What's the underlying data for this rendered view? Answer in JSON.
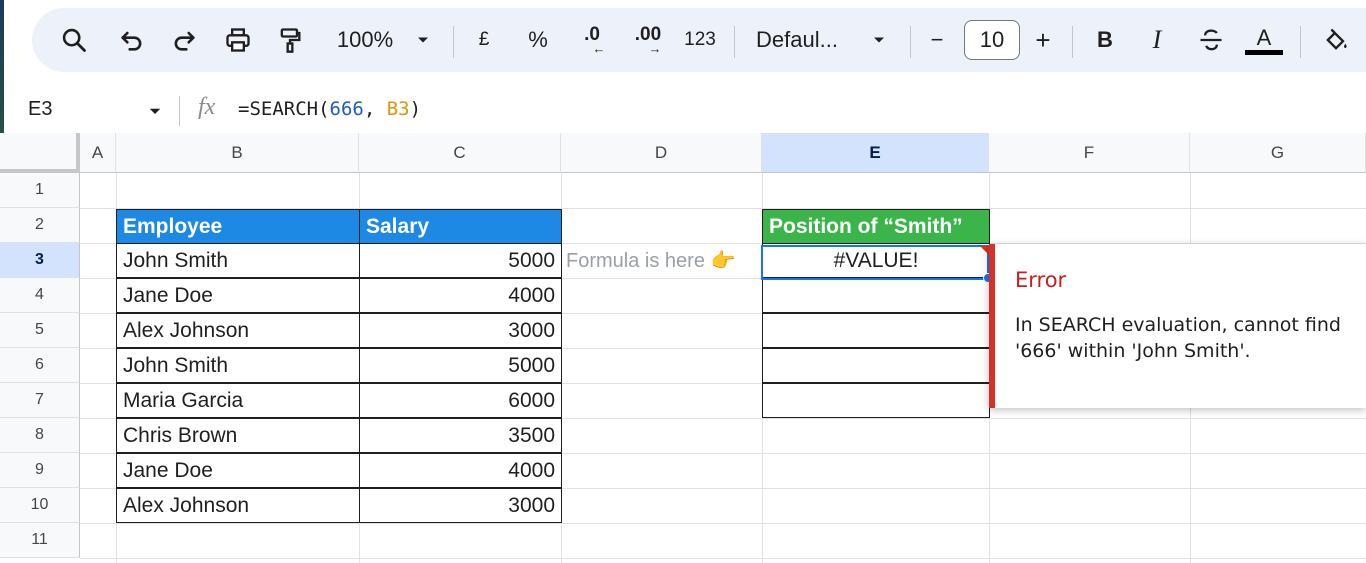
{
  "toolbar": {
    "zoom": "100%",
    "currency": "£",
    "percent": "%",
    "decrease_decimals": ".0",
    "increase_decimals": ".00",
    "more_formats": "123",
    "font": "Defaul...",
    "font_size": "10",
    "minus": "−",
    "plus": "+",
    "bold": "B",
    "italic": "I",
    "text_color": "A",
    "icons": [
      "search-icon",
      "undo-icon",
      "redo-icon",
      "print-icon",
      "paint-format-icon",
      "chevron-down-icon",
      "strikethrough-icon",
      "fill-color-icon"
    ]
  },
  "formula_bar": {
    "cell_ref": "E3",
    "fx": "fx",
    "formula_start": "=SEARCH(",
    "formula_arg1": "666",
    "formula_sep": ", ",
    "formula_arg2": "B3",
    "formula_end": ")"
  },
  "columns": [
    "A",
    "B",
    "C",
    "D",
    "E",
    "F",
    "G"
  ],
  "selected_column": "E",
  "rows": [
    "1",
    "2",
    "3",
    "4",
    "5",
    "6",
    "7",
    "8",
    "9",
    "10",
    "11"
  ],
  "selected_row": "3",
  "table": {
    "headers": [
      "Employee",
      "Salary"
    ],
    "header_color": "#1e88e5",
    "rows": [
      {
        "employee": "John Smith",
        "salary": "5000"
      },
      {
        "employee": "Jane Doe",
        "salary": "4000"
      },
      {
        "employee": "Alex Johnson",
        "salary": "3000"
      },
      {
        "employee": "John Smith",
        "salary": "5000"
      },
      {
        "employee": "Maria Garcia",
        "salary": "6000"
      },
      {
        "employee": "Chris Brown",
        "salary": "3500"
      },
      {
        "employee": "Jane Doe",
        "salary": "4000"
      },
      {
        "employee": "Alex Johnson",
        "salary": "3000"
      }
    ]
  },
  "result": {
    "header": "Position of “Smith”",
    "header_color": "#3bb54a",
    "value": "#VALUE!"
  },
  "note": "Formula is here 👉",
  "error": {
    "title": "Error",
    "message": "In SEARCH evaluation, cannot find '666' within 'John Smith'.",
    "color": "#d93025"
  }
}
